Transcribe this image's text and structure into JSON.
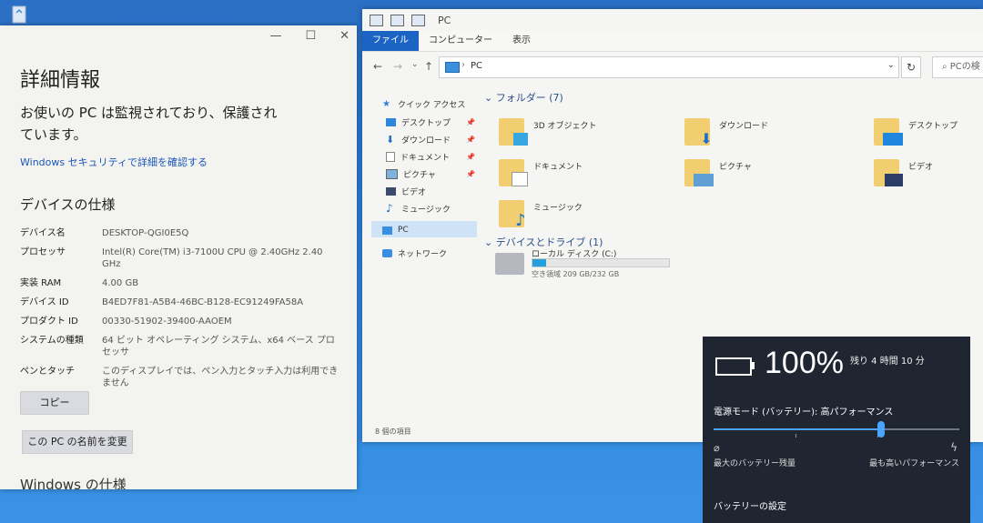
{
  "desktop": {
    "recycle_icon": "recycle-bin-icon"
  },
  "settings": {
    "controls": {
      "minimize": "—",
      "maximize": "☐",
      "close": "✕"
    },
    "title": "詳細情報",
    "status": "お使いの PC は監視されており、保護されています。",
    "security_link": "Windows セキュリティで詳細を確認する",
    "spec_title": "デバイスの仕様",
    "specs": [
      {
        "key": "デバイス名",
        "value": "DESKTOP-QGI0E5Q"
      },
      {
        "key": "プロセッサ",
        "value": "Intel(R) Core(TM) i3-7100U CPU @ 2.40GHz   2.40 GHz"
      },
      {
        "key": "実装 RAM",
        "value": "4.00 GB"
      },
      {
        "key": "デバイス ID",
        "value": "B4ED7F81-A5B4-46BC-B128-EC91249FA58A"
      },
      {
        "key": "プロダクト ID",
        "value": "00330-51902-39400-AAOEM"
      },
      {
        "key": "システムの種類",
        "value": "64 ビット オペレーティング システム、x64 ベース プロセッサ"
      },
      {
        "key": "ペンとタッチ",
        "value": "このディスプレイでは、ペン入力とタッチ入力は利用できません"
      }
    ],
    "copy_button": "コピー",
    "rename_button": "この PC の名前を変更",
    "windows_spec_title": "Windows の仕様"
  },
  "explorer": {
    "title": "PC",
    "ribbon_tabs": [
      "ファイル",
      "コンピューター",
      "表示"
    ],
    "nav": {
      "back": "←",
      "forward": "→",
      "recent": "⌄",
      "up": "↑"
    },
    "address": {
      "separator": "›",
      "path": "PC",
      "dropdown": "⌄"
    },
    "refresh": "↻",
    "search_placeholder": "⌕ PCの検",
    "nav_pane": [
      {
        "label": "クイック アクセス",
        "icon": "star-icon",
        "pinned": false
      },
      {
        "label": "デスクトップ",
        "icon": "desktop-icon",
        "pinned": true
      },
      {
        "label": "ダウンロード",
        "icon": "download-icon",
        "pinned": true
      },
      {
        "label": "ドキュメント",
        "icon": "document-icon",
        "pinned": true
      },
      {
        "label": "ピクチャ",
        "icon": "pictures-icon",
        "pinned": true
      },
      {
        "label": "ビデオ",
        "icon": "video-icon",
        "pinned": false
      },
      {
        "label": "ミュージック",
        "icon": "music-icon",
        "pinned": false
      },
      {
        "label": "PC",
        "icon": "pc-icon",
        "pinned": false
      },
      {
        "label": "ネットワーク",
        "icon": "network-icon",
        "pinned": false
      }
    ],
    "pin_glyph": "📌",
    "folders_header": "フォルダー (7)",
    "folders": [
      {
        "label": "3D オブジェクト",
        "icon": "3d-objects-folder-icon"
      },
      {
        "label": "ダウンロード",
        "icon": "downloads-folder-icon"
      },
      {
        "label": "デスクトップ",
        "icon": "desktop-folder-icon"
      },
      {
        "label": "ドキュメント",
        "icon": "documents-folder-icon"
      },
      {
        "label": "ピクチャ",
        "icon": "pictures-folder-icon"
      },
      {
        "label": "ビデオ",
        "icon": "videos-folder-icon"
      },
      {
        "label": "ミュージック",
        "icon": "music-folder-icon"
      }
    ],
    "drives_header": "デバイスとドライブ (1)",
    "drive": {
      "name": "ローカル ディスク (C:)",
      "free": "空き領域 209 GB/232 GB",
      "used_fraction": 0.1
    },
    "status": "8 個の項目",
    "accent": "#1c64c4"
  },
  "battery": {
    "percent": "100%",
    "remaining": "残り 4 時間 10 分",
    "mode_label": "電源モード (バッテリー): 高パフォーマンス",
    "slider_level": 0.68,
    "left_label": "最大のバッテリー残量",
    "right_label": "最も高いパフォーマンス",
    "leaf_glyph": "⌀",
    "bolt_glyph": "ϟ",
    "settings_link": "バッテリーの設定",
    "accent": "#4aa3ff"
  }
}
